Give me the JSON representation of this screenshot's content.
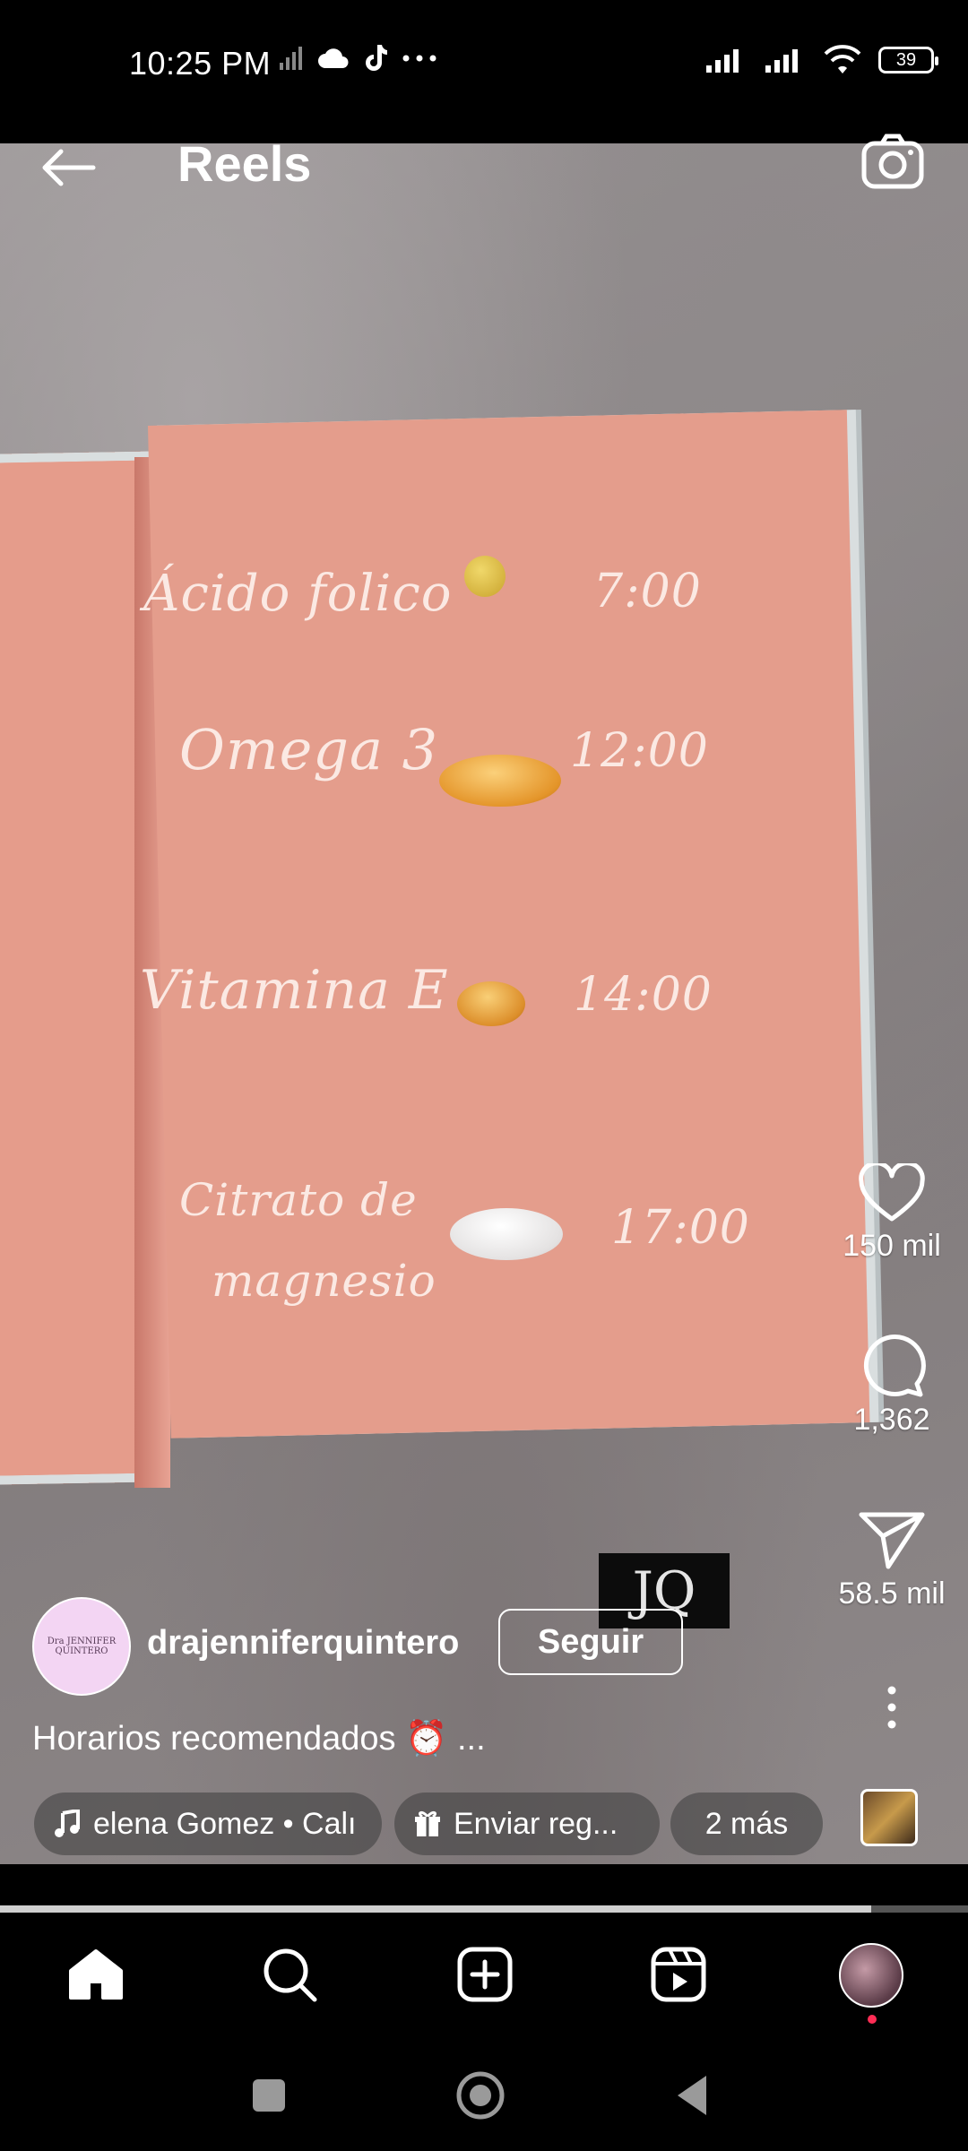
{
  "status_bar": {
    "time": "10:25 PM",
    "battery": "39"
  },
  "header": {
    "title": "Reels"
  },
  "reel": {
    "items": [
      {
        "name": "Ácido folico",
        "time": "7:00"
      },
      {
        "name": "Omega 3",
        "time": "12:00"
      },
      {
        "name": "Vitamina E",
        "time": "14:00"
      },
      {
        "name_line1": "Citrato de",
        "name_line2": "magnesio",
        "time": "17:00"
      }
    ],
    "watermark": "JQ"
  },
  "actions": {
    "likes": "150 mil",
    "comments": "1,362",
    "shares": "58.5 mil"
  },
  "author": {
    "username": "drajenniferquintero",
    "follow_label": "Seguir",
    "avatar_text": "Dra JENNIFER QUINTERO"
  },
  "caption": "Horarios recomendados ⏰ ...",
  "chips": {
    "music": "elena Gomez • Calı",
    "gift": "Enviar reg...",
    "more": "2 más"
  },
  "progress": {
    "fraction": 0.9
  },
  "colors": {
    "page_pink": "#e49d8c",
    "script_text": "#fbe9e3",
    "notification_dot": "#ff2d55"
  }
}
